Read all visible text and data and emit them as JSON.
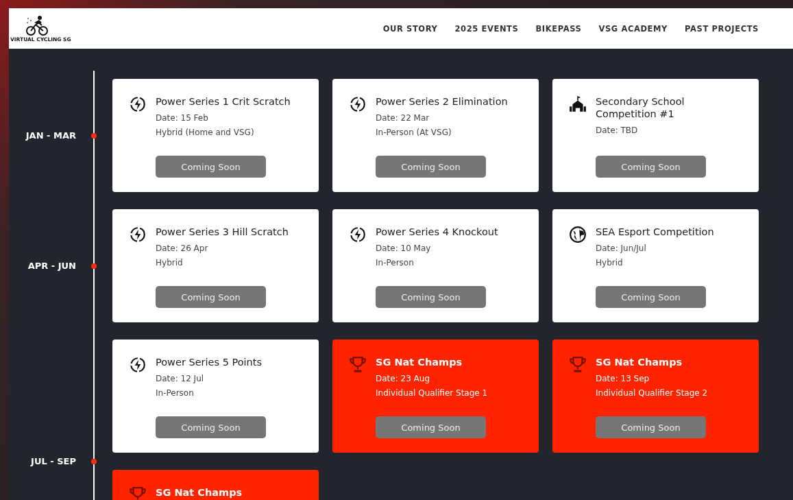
{
  "header": {
    "logo_text": "VIRTUAL CYCLING SG",
    "nav": [
      "OUR STORY",
      "2025 EVENTS",
      "BIKEPASS",
      "VSG ACADEMY",
      "PAST PROJECTS"
    ]
  },
  "timeline": [
    "JAN - MAR",
    "APR - JUN",
    "JUL - SEP"
  ],
  "events": [
    {
      "kind": "bolt",
      "highlight": false,
      "title": "Power Series 1 Crit Scratch",
      "lines": [
        "Date: 15 Feb",
        "Hybrid (Home and VSG)"
      ],
      "button": "Coming Soon"
    },
    {
      "kind": "bolt",
      "highlight": false,
      "title": "Power Series 2 Elimination",
      "lines": [
        "Date: 22 Mar",
        "In-Person (At VSG)"
      ],
      "button": "Coming Soon"
    },
    {
      "kind": "school",
      "highlight": false,
      "title": "Secondary School Competition #1",
      "lines": [
        "Date: TBD"
      ],
      "button": "Coming Soon"
    },
    {
      "kind": "bolt",
      "highlight": false,
      "title": "Power Series 3 Hill Scratch",
      "lines": [
        "Date: 26 Apr",
        "Hybrid"
      ],
      "button": "Coming Soon"
    },
    {
      "kind": "bolt",
      "highlight": false,
      "title": "Power Series 4 Knockout",
      "lines": [
        "Date: 10 May",
        "In-Person"
      ],
      "button": "Coming Soon"
    },
    {
      "kind": "globe",
      "highlight": false,
      "title": "SEA Esport Competition",
      "lines": [
        "Date: Jun/Jul",
        "Hybrid"
      ],
      "button": "Coming Soon"
    },
    {
      "kind": "bolt",
      "highlight": false,
      "title": "Power Series 5 Points",
      "lines": [
        "Date: 12 Jul",
        "In-Person"
      ],
      "button": "Coming Soon"
    },
    {
      "kind": "trophy",
      "highlight": true,
      "title": "SG Nat Champs",
      "lines": [
        "Date: 23 Aug",
        "Individual Qualifier Stage 1"
      ],
      "button": "Coming Soon"
    },
    {
      "kind": "trophy",
      "highlight": true,
      "title": "SG Nat Champs",
      "lines": [
        "Date: 13 Sep",
        "Individual Qualifier Stage 2"
      ],
      "button": "Coming Soon"
    },
    {
      "kind": "trophy",
      "highlight": true,
      "title": "SG Nat Champs"
    }
  ]
}
